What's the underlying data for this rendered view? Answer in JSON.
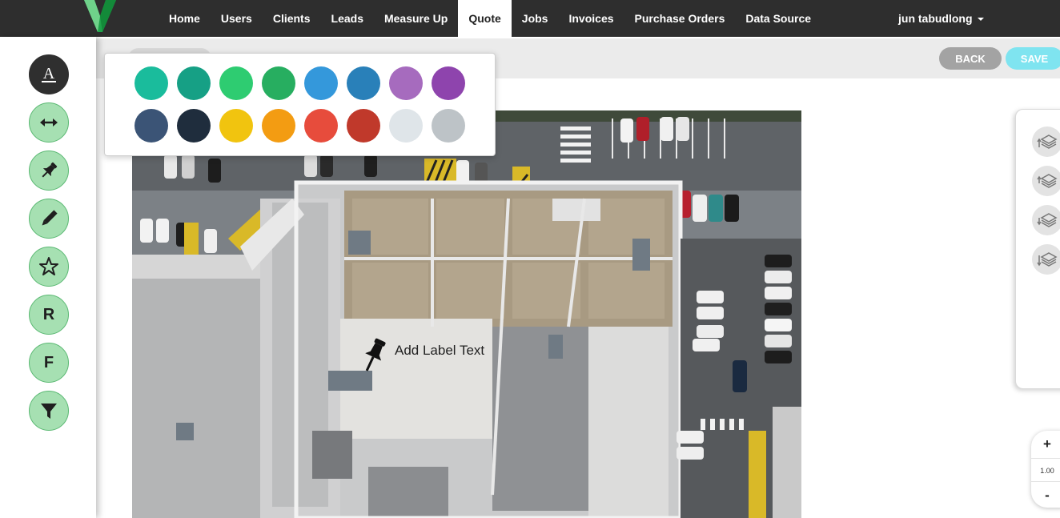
{
  "nav": {
    "logo_icon": "v-logo-icon",
    "items": [
      "Home",
      "Users",
      "Clients",
      "Leads",
      "Measure Up",
      "Quote",
      "Jobs",
      "Invoices",
      "Purchase Orders",
      "Data Source"
    ],
    "active": "Quote",
    "user": "jun tabudlong"
  },
  "toolbar": {
    "back_label": "BACK",
    "save_label": "SAVE"
  },
  "tools": [
    {
      "name": "text-tool",
      "icon": "text-underline-icon",
      "active": true
    },
    {
      "name": "measure-tool",
      "icon": "double-arrow-icon"
    },
    {
      "name": "pin-tool",
      "icon": "pushpin-icon"
    },
    {
      "name": "draw-tool",
      "icon": "pencil-icon"
    },
    {
      "name": "star-tool",
      "icon": "star-icon"
    },
    {
      "name": "r-tool",
      "label": "R"
    },
    {
      "name": "f-tool",
      "label": "F"
    },
    {
      "name": "filter-tool",
      "icon": "filter-icon"
    }
  ],
  "color_picker": {
    "colors": [
      "#1abc9c",
      "#16a085",
      "#2ecc71",
      "#27ae60",
      "#3498db",
      "#2980b9",
      "#a66bbe",
      "#8e44ad",
      "#3b5476",
      "#1f2d3d",
      "#f1c40f",
      "#f39c12",
      "#e74c3c",
      "#c0392b",
      "#dfe5e9",
      "#bdc3c7"
    ]
  },
  "canvas": {
    "pin_icon": "pushpin-icon",
    "pin_label": "Add Label Text"
  },
  "layers": {
    "buttons": [
      "bring-to-front-icon",
      "bring-forward-icon",
      "send-backward-icon",
      "send-to-back-icon"
    ]
  },
  "zoom": {
    "in_label": "+",
    "level": "1.00",
    "out_label": "-"
  }
}
